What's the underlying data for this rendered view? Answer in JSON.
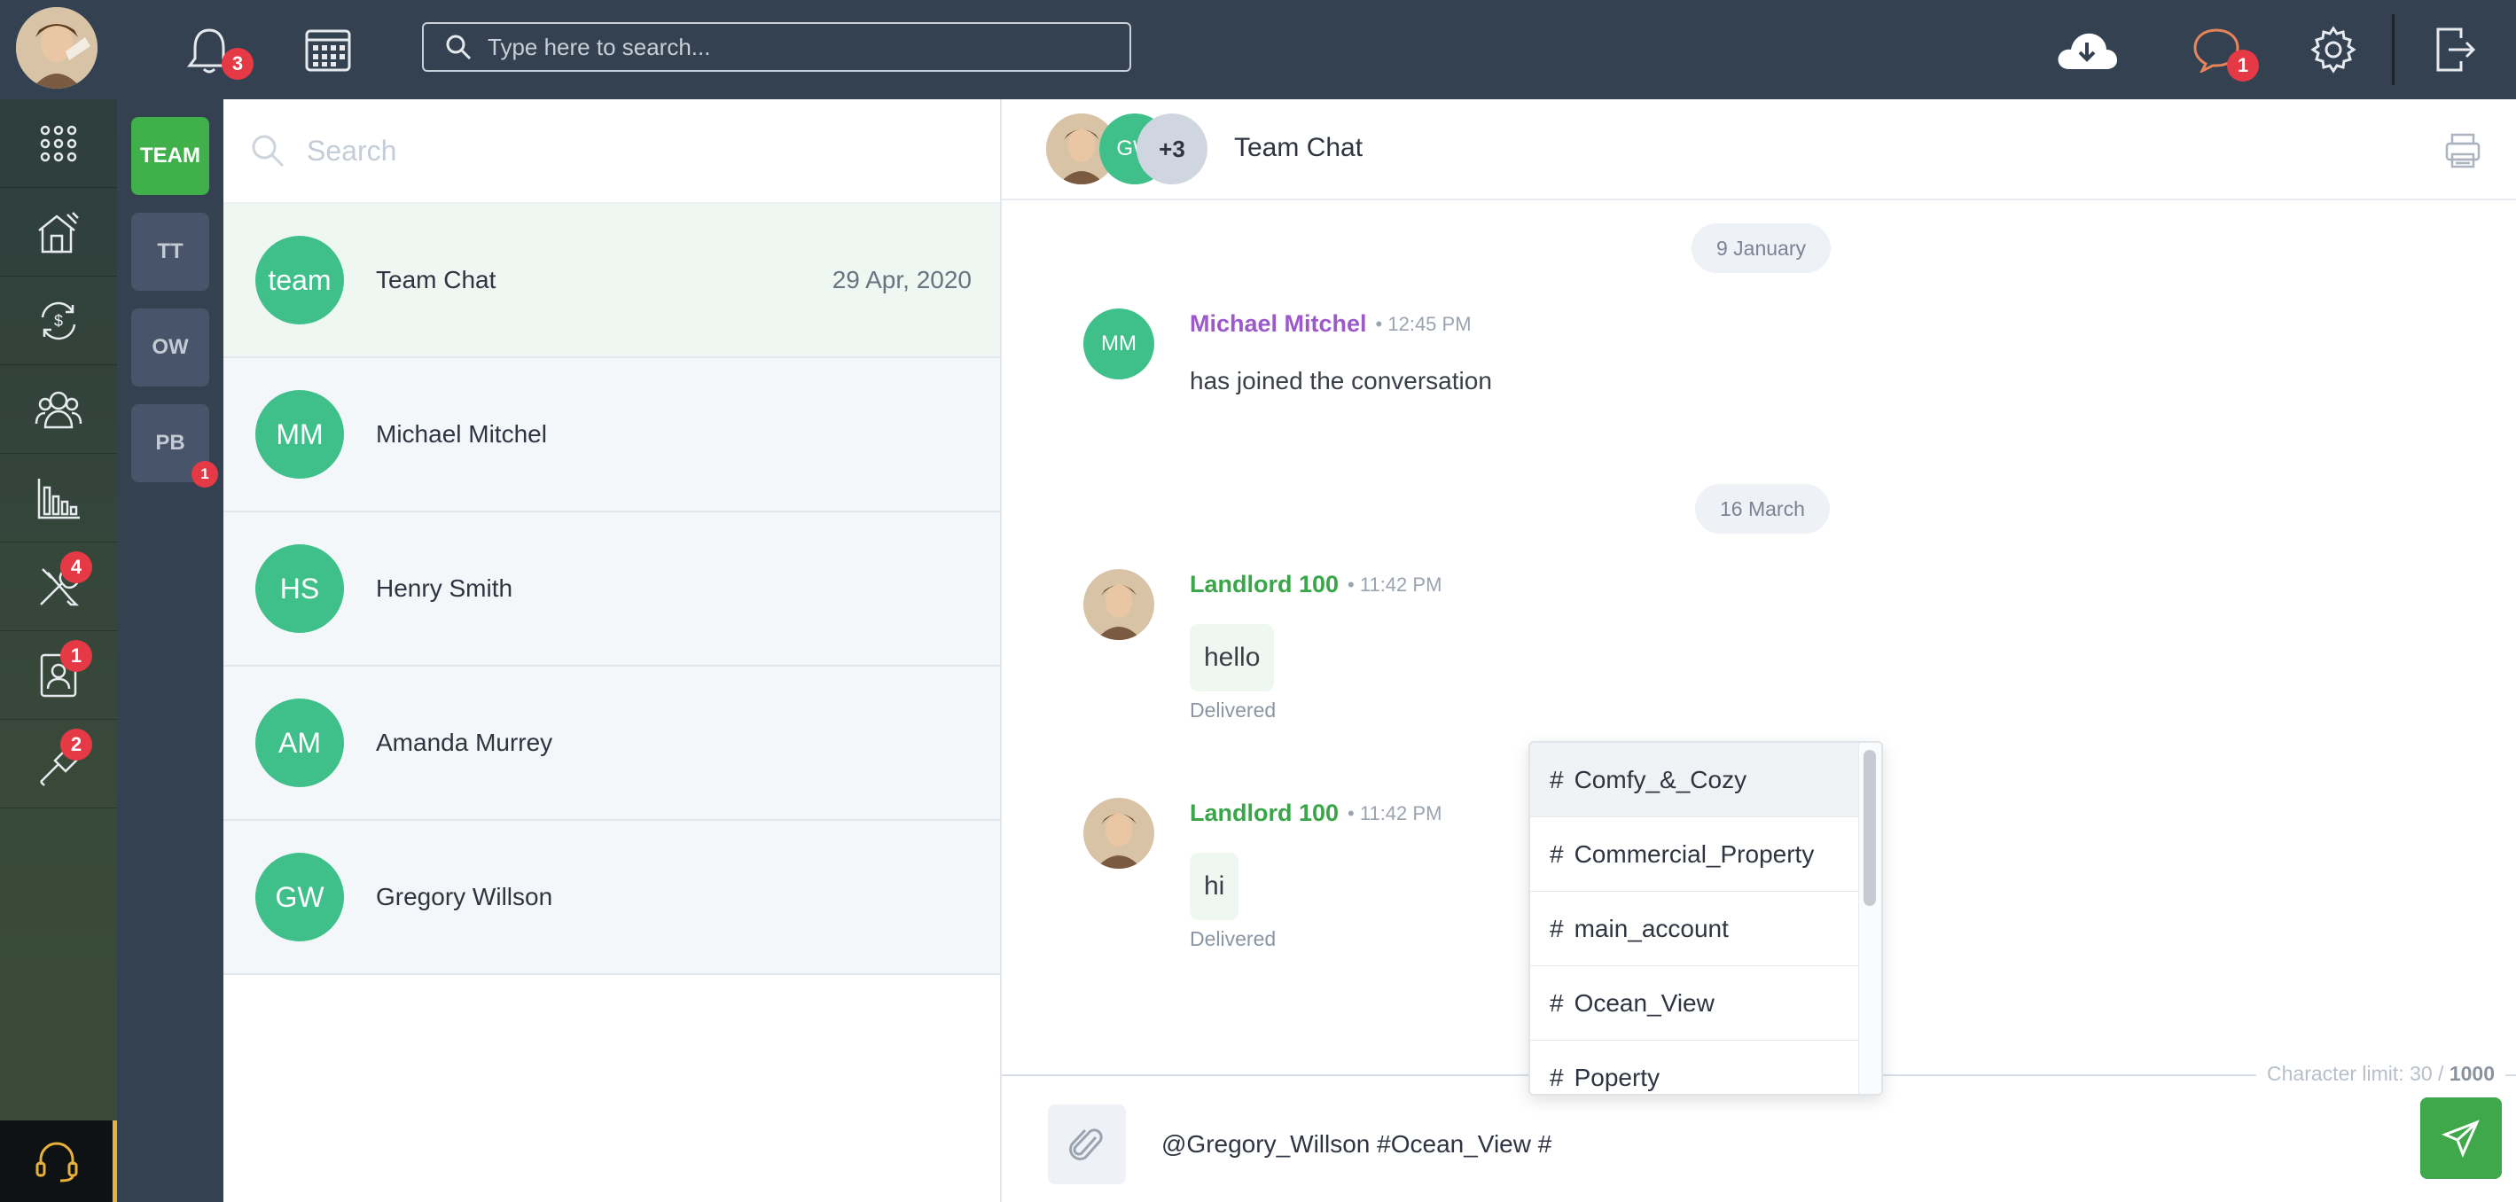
{
  "topbar": {
    "notifications_badge": "3",
    "search_placeholder": "Type here to search...",
    "chat_badge": "1"
  },
  "leftnav": {
    "items": [
      {
        "icon": "apps-grid-icon"
      },
      {
        "icon": "properties-icon"
      },
      {
        "icon": "finance-exchange-icon"
      },
      {
        "icon": "contacts-icon"
      },
      {
        "icon": "reports-chart-icon"
      },
      {
        "icon": "maintenance-tools-icon",
        "badge": "4"
      },
      {
        "icon": "tenant-profile-icon",
        "badge": "1"
      },
      {
        "icon": "repair-hammer-icon",
        "badge": "2"
      }
    ],
    "support_icon": "headset-icon"
  },
  "workspaces": [
    {
      "label": "TEAM",
      "active": true
    },
    {
      "label": "TT"
    },
    {
      "label": "OW"
    },
    {
      "label": "PB",
      "badge": "1"
    }
  ],
  "conversations": {
    "search_placeholder": "Search",
    "items": [
      {
        "initials": "team",
        "name": "Team Chat",
        "date": "29 Apr, 2020"
      },
      {
        "initials": "MM",
        "name": "Michael Mitchel",
        "date": ""
      },
      {
        "initials": "HS",
        "name": "Henry Smith",
        "date": ""
      },
      {
        "initials": "AM",
        "name": "Amanda Murrey",
        "date": ""
      },
      {
        "initials": "GW",
        "name": "Gregory Willson",
        "date": ""
      }
    ]
  },
  "chat": {
    "title": "Team Chat",
    "header_avatar_gw": "GW",
    "header_more": "+3",
    "date1": "9 January",
    "date2": "16 March",
    "messages": [
      {
        "avatar": "MM",
        "sender": "Michael Mitchel",
        "time": "• 12:45 PM",
        "text": "has joined the conversation",
        "sender_color": "#9b59c9"
      },
      {
        "sender": "Landlord 100",
        "time": "• 11:42 PM",
        "text": "hello",
        "status": "Delivered",
        "sender_color": "#3aa64a"
      },
      {
        "sender": "Landlord 100",
        "time": "• 11:42 PM",
        "text": "hi",
        "status": "Delivered",
        "sender_color": "#3aa64a"
      }
    ],
    "char_limit_label": "Character limit: 30 /",
    "char_limit_max": "1000",
    "input_value": "@Gregory_Willson #Ocean_View #",
    "hashtag_options": [
      "Comfy_&_Cozy",
      "Commercial_Property",
      "main_account",
      "Ocean_View",
      "Poperty"
    ]
  },
  "colors": {
    "topbar": "#334150",
    "accent_green": "#3fb04a",
    "avatar_green": "#3fc08a",
    "badge_red": "#e53946"
  }
}
